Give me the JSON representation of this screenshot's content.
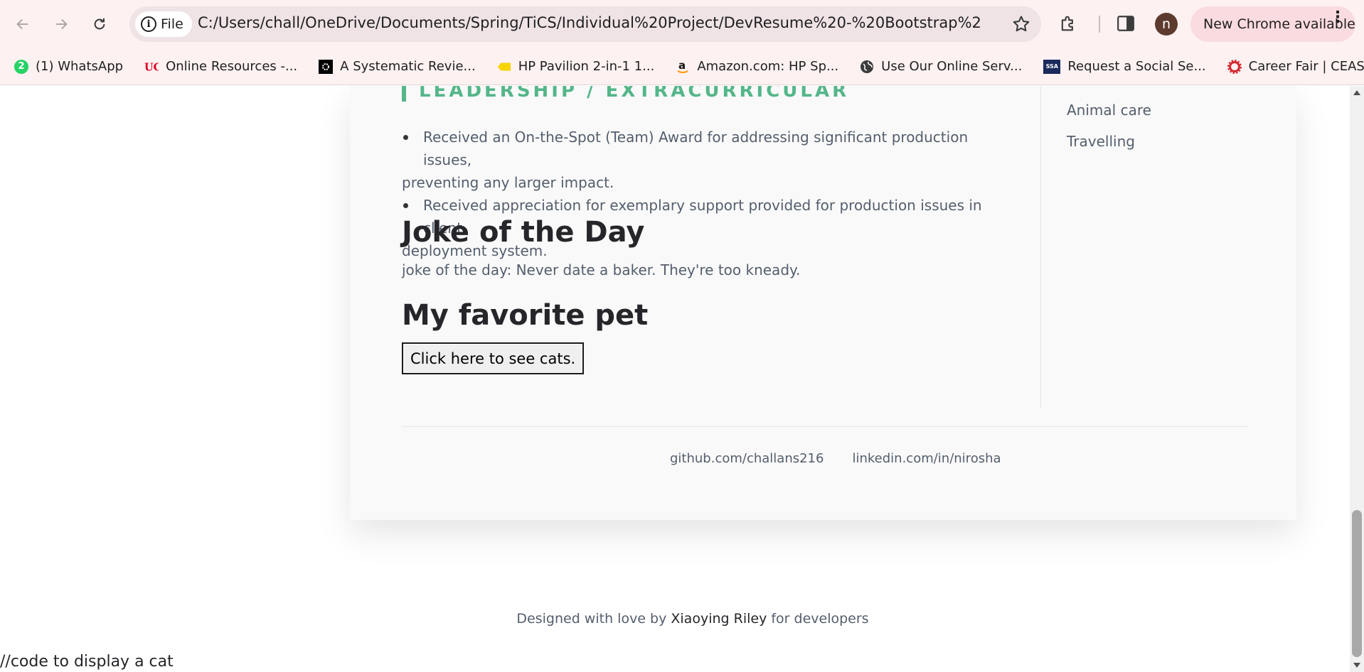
{
  "browser": {
    "chip_label": "File",
    "url": "C:/Users/chall/OneDrive/Documents/Spring/TiCS/Individual%20Project/DevResume%20-%20Bootstrap%20Resume_CV%...",
    "avatar_letter": "n",
    "update_label": "New Chrome available",
    "bookmarks": [
      {
        "label": "(1) WhatsApp",
        "badge": "2",
        "icon": "whatsapp-icon",
        "color": "#25d366"
      },
      {
        "label": "Online Resources -...",
        "icon": "uc-logo-icon",
        "color": "#e00122"
      },
      {
        "label": "A Systematic Revie...",
        "icon": "gear-logo-icon",
        "color": "#1f1f1f"
      },
      {
        "label": "HP Pavilion 2-in-1 1...",
        "icon": "tag-icon",
        "color": "#f5d400"
      },
      {
        "label": "Amazon.com: HP Sp...",
        "icon": "amazon-icon",
        "color": "#1f1f1f"
      },
      {
        "label": "Use Our Online Serv...",
        "icon": "globe-icon",
        "color": "#3c3c3c"
      },
      {
        "label": "Request a Social Se...",
        "icon": "ssa-icon",
        "color": "#1b2a5c",
        "badge": "SSA"
      },
      {
        "label": "Career Fair | CEAS Tr...",
        "icon": "ceas-gear-icon",
        "color": "#d4282f"
      }
    ]
  },
  "resume": {
    "section_title": "LEADERSHIP / EXTRACURRICULAR",
    "achievements": [
      {
        "line1": "Received an On-the-Spot (Team) Award for addressing significant production issues,",
        "line2": "preventing any larger impact."
      },
      {
        "line1": "Received appreciation for exemplary support provided for production issues in client",
        "line2": "deployment system."
      }
    ],
    "joke_heading": "Joke of the Day",
    "joke_text": "joke of the day: Never date a baker. They're too kneady.",
    "pet_heading": "My favorite pet",
    "cats_button": "Click here to see cats.",
    "interests": [
      "Animal care",
      "Travelling"
    ],
    "footer_links": [
      "github.com/challans216",
      "linkedin.com/in/nirosha"
    ],
    "credit": {
      "prefix": "Designed with love by",
      "author": "Xiaoying Riley",
      "suffix": "for developers"
    },
    "code_comment": "//code to display a cat"
  },
  "colors": {
    "accent": "#54b689",
    "text": "#545e6c",
    "heading": "#26262a"
  }
}
